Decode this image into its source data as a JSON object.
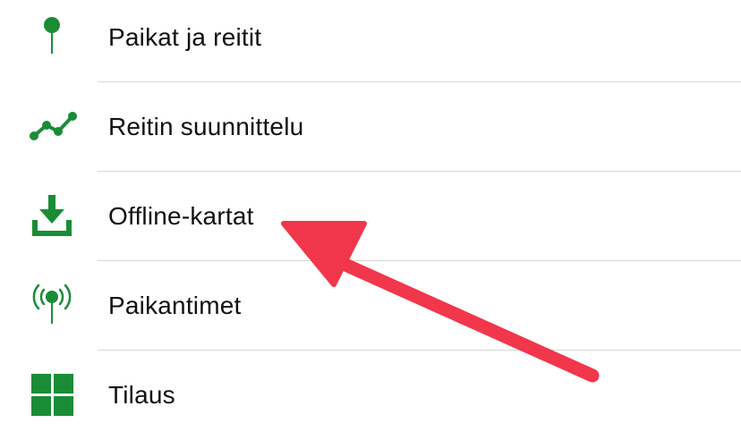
{
  "colors": {
    "icon_green": "#1a8c36",
    "annotation_red": "#f2364b",
    "divider": "#d6d6d6"
  },
  "menu": {
    "items": [
      {
        "label": "Paikat ja reitit",
        "icon": "map-pin-icon"
      },
      {
        "label": "Reitin suunnittelu",
        "icon": "route-plan-icon"
      },
      {
        "label": "Offline-kartat",
        "icon": "download-icon"
      },
      {
        "label": "Paikantimet",
        "icon": "tracker-signal-icon"
      },
      {
        "label": "Tilaus",
        "icon": "grid-icon"
      }
    ]
  },
  "annotation": {
    "type": "arrow",
    "color": "#f2364b",
    "points_to": "Offline-kartat"
  }
}
